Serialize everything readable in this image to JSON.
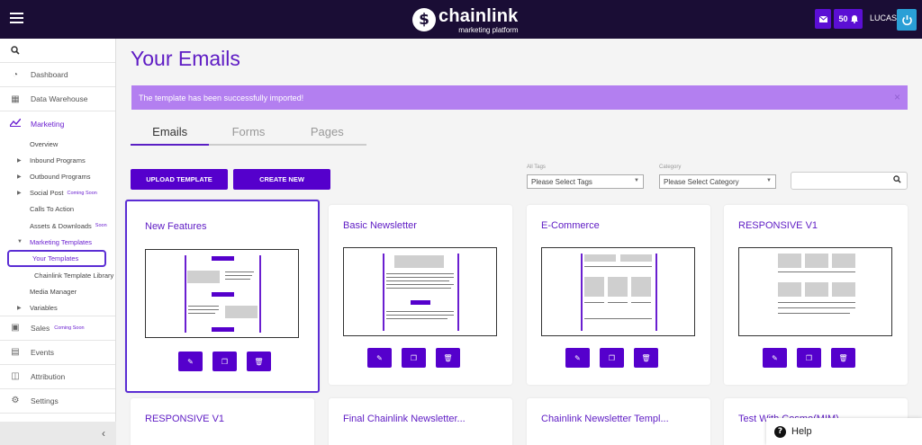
{
  "app": {
    "logo_name": "chainlink",
    "logo_sub": "marketing platform",
    "user_name": "LUCAS",
    "notif_count": "50",
    "accent": "#5500cc",
    "topbar_bg": "#1a0d35"
  },
  "sidebar": {
    "items": [
      {
        "label": "Dashboard",
        "icon": "dashboard-icon"
      },
      {
        "label": "Data Warehouse",
        "icon": "warehouse-icon"
      },
      {
        "label": "Marketing",
        "icon": "chart-line-icon"
      },
      {
        "label": "Sales",
        "tag": "Coming Soon",
        "icon": "dollar-icon"
      },
      {
        "label": "Events",
        "icon": "calendar-icon"
      },
      {
        "label": "Attribution",
        "icon": "attribution-icon"
      },
      {
        "label": "Settings",
        "icon": "gear-icon"
      }
    ],
    "marketing_sub": [
      {
        "label": "Overview"
      },
      {
        "label": "Inbound Programs"
      },
      {
        "label": "Outbound Programs"
      },
      {
        "label": "Social Post",
        "tag": "Coming Soon"
      },
      {
        "label": "Calls To Action"
      },
      {
        "label": "Assets & Downloads",
        "tag": "Soon"
      },
      {
        "label": "Marketing Templates"
      },
      {
        "label": "Your Templates"
      },
      {
        "label": "Chainlink Template Library"
      },
      {
        "label": "Media Manager"
      },
      {
        "label": "Variables"
      }
    ]
  },
  "main": {
    "title": "Your Emails",
    "alert": "The template has been successfully imported!",
    "alert_close": "×",
    "tabs": [
      {
        "label": "Emails"
      },
      {
        "label": "Forms"
      },
      {
        "label": "Pages"
      }
    ],
    "upload_label": "UPLOAD TEMPLATE",
    "create_label": "CREATE NEW",
    "tags_filter": {
      "label": "All Tags",
      "value": "Please Select Tags"
    },
    "category_filter": {
      "label": "Category",
      "value": "Please Select Category"
    }
  },
  "cards": [
    {
      "title": "New Features"
    },
    {
      "title": "Basic Newsletter"
    },
    {
      "title": "E-Commerce"
    },
    {
      "title": "RESPONSIVE V1"
    },
    {
      "title": "RESPONSIVE V1"
    },
    {
      "title": "Final Chainlink Newsletter..."
    },
    {
      "title": "Chainlink Newsletter Templ..."
    },
    {
      "title": "Test With Cosmo(MIM)"
    }
  ],
  "help": {
    "label": "Help"
  }
}
